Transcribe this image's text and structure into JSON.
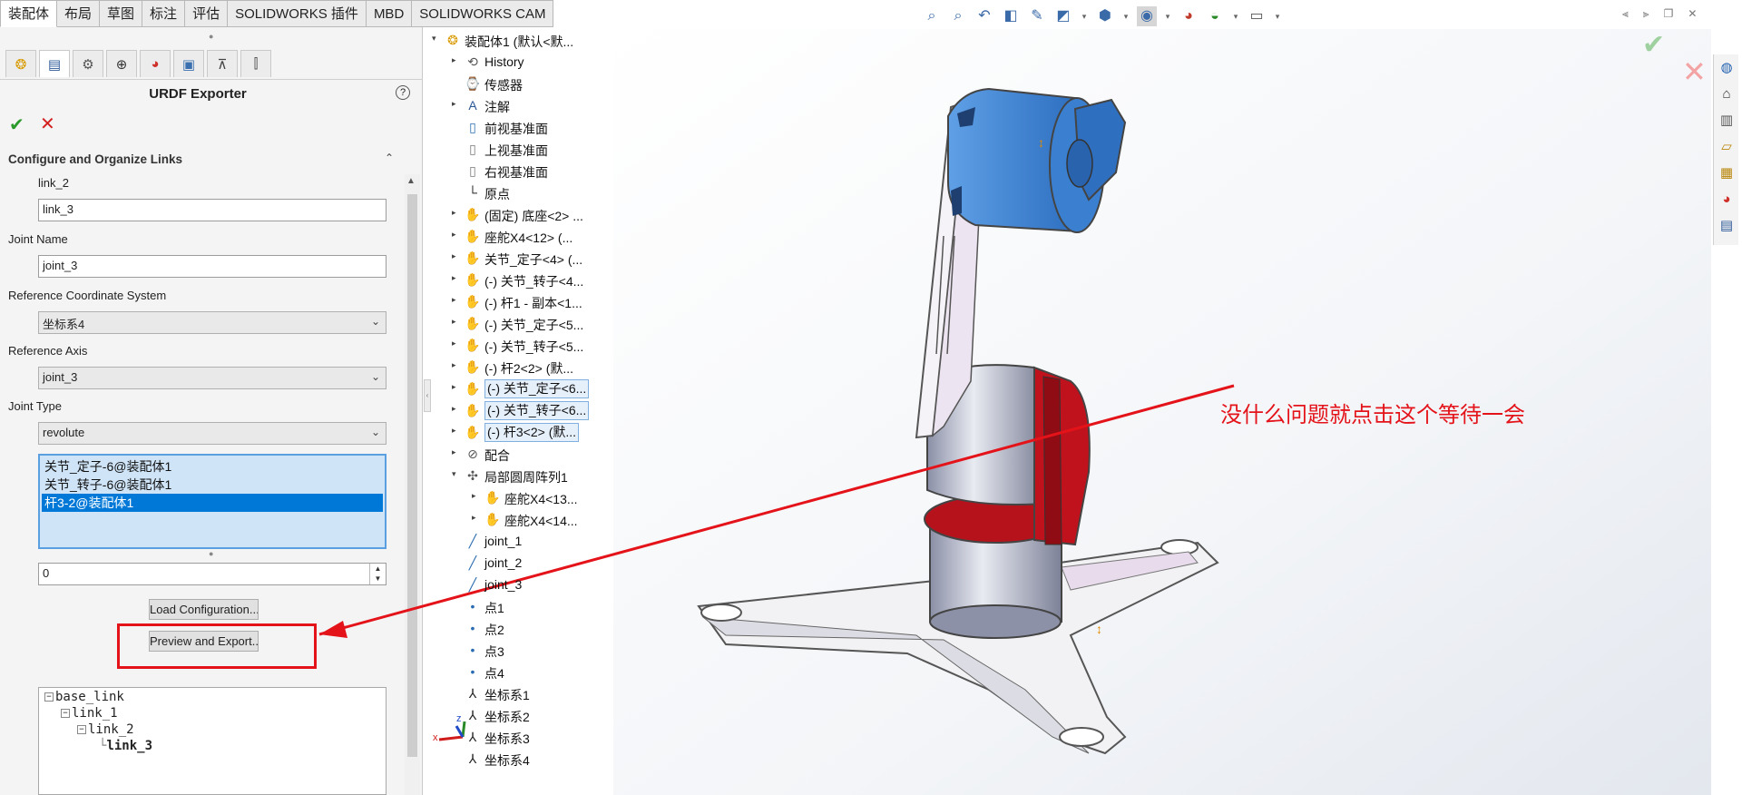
{
  "command_tabs": [
    "装配体",
    "布局",
    "草图",
    "标注",
    "评估",
    "SOLIDWORKS 插件",
    "MBD",
    "SOLIDWORKS CAM"
  ],
  "pm": {
    "title": "URDF Exporter",
    "section_title": "Configure and Organize Links",
    "parent_link": "link_2",
    "link_name": "link_3",
    "joint_name_label": "Joint Name",
    "joint_name": "joint_3",
    "ref_coord_label": "Reference Coordinate System",
    "ref_coord": "坐标系4",
    "ref_axis_label": "Reference Axis",
    "ref_axis": "joint_3",
    "joint_type_label": "Joint Type",
    "joint_type": "revolute",
    "components": [
      "关节_定子-6@装配体1",
      "关节_转子-6@装配体1",
      "杆3-2@装配体1"
    ],
    "spin_value": "0",
    "load_button": "Load Configuration...",
    "export_button": "Preview and Export...",
    "link_tree": [
      "base_link",
      "link_1",
      "link_2",
      "link_3"
    ]
  },
  "feature_tree": [
    {
      "label": "装配体1  (默认<默...",
      "icon": "assembly-icon"
    },
    {
      "label": "History",
      "icon": "history-icon"
    },
    {
      "label": "传感器",
      "icon": "sensor-icon"
    },
    {
      "label": "注解",
      "icon": "annotation-icon"
    },
    {
      "label": "前视基准面",
      "icon": "plane-icon"
    },
    {
      "label": "上视基准面",
      "icon": "plane-icon"
    },
    {
      "label": "右视基准面",
      "icon": "plane-icon"
    },
    {
      "label": "原点",
      "icon": "origin-icon"
    },
    {
      "label": "(固定) 底座<2> ...",
      "icon": "part-icon"
    },
    {
      "label": "座舵X4<12> (...",
      "icon": "part-icon"
    },
    {
      "label": "关节_定子<4> (...",
      "icon": "part-icon"
    },
    {
      "label": "(-) 关节_转子<4...",
      "icon": "part-icon"
    },
    {
      "label": "(-) 杆1 - 副本<1...",
      "icon": "part-icon"
    },
    {
      "label": "(-) 关节_定子<5...",
      "icon": "part-icon"
    },
    {
      "label": "(-) 关节_转子<5...",
      "icon": "part-icon"
    },
    {
      "label": "(-) 杆2<2> (默...",
      "icon": "part-icon"
    },
    {
      "label": "(-) 关节_定子<6...",
      "icon": "part-icon"
    },
    {
      "label": "(-) 关节_转子<6...",
      "icon": "part-icon"
    },
    {
      "label": "(-) 杆3<2> (默...",
      "icon": "part-icon"
    },
    {
      "label": "配合",
      "icon": "mate-icon"
    },
    {
      "label": "局部圆周阵列1",
      "icon": "pattern-icon"
    },
    {
      "label": "座舵X4<13...",
      "icon": "part-icon"
    },
    {
      "label": "座舵X4<14...",
      "icon": "part-icon"
    },
    {
      "label": "joint_1",
      "icon": "axis-icon"
    },
    {
      "label": "joint_2",
      "icon": "axis-icon"
    },
    {
      "label": "joint_3",
      "icon": "axis-icon"
    },
    {
      "label": "点1",
      "icon": "point-icon"
    },
    {
      "label": "点2",
      "icon": "point-icon"
    },
    {
      "label": "点3",
      "icon": "point-icon"
    },
    {
      "label": "点4",
      "icon": "point-icon"
    },
    {
      "label": "坐标系1",
      "icon": "coordsys-icon"
    },
    {
      "label": "坐标系2",
      "icon": "coordsys-icon"
    },
    {
      "label": "坐标系3",
      "icon": "coordsys-icon"
    },
    {
      "label": "坐标系4",
      "icon": "coordsys-icon"
    }
  ],
  "annotation_text": "没什么问题就点击这个等待一会",
  "axis_labels": {
    "x": "x",
    "z": "z"
  },
  "colors": {
    "accent": "#0078d7",
    "annotation_red": "#e4131a",
    "ok_green": "#2a9a2a",
    "part_blue": "#3a7fd0",
    "part_red": "#c01a1a"
  }
}
